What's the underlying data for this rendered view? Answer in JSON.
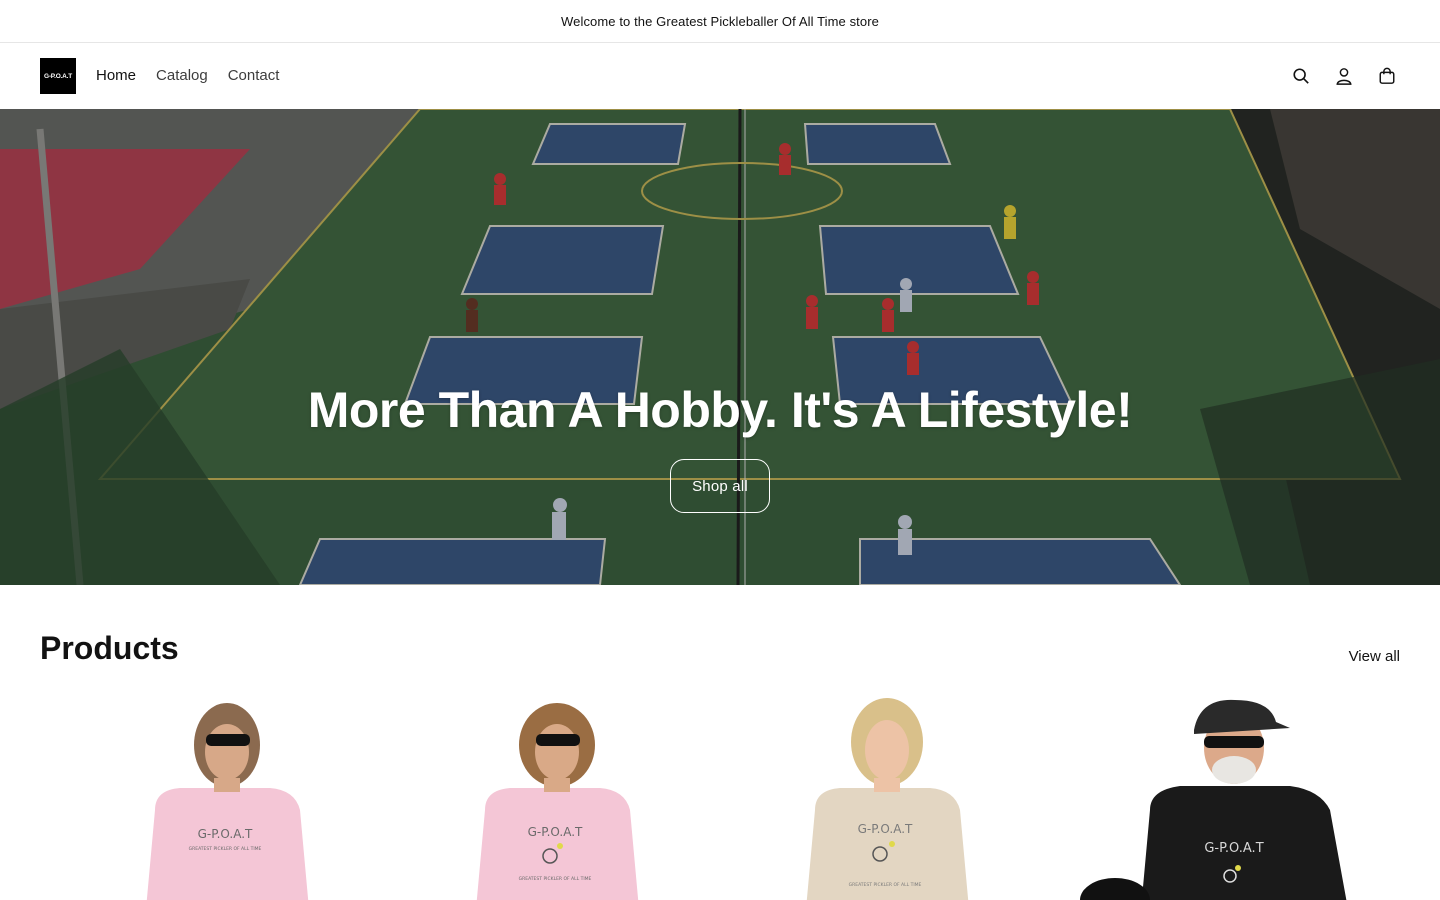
{
  "announcement": {
    "text": "Welcome to the Greatest Pickleballer Of All Time store"
  },
  "header": {
    "logo_text": "G-P.O.A.T",
    "nav": [
      {
        "label": "Home",
        "active": true
      },
      {
        "label": "Catalog",
        "active": false
      },
      {
        "label": "Contact",
        "active": false
      }
    ],
    "icons": [
      "search-icon",
      "account-icon",
      "cart-icon"
    ]
  },
  "hero": {
    "title": "More Than A Hobby. It's A Lifestyle!",
    "button_label": "Shop all",
    "colors": {
      "court_surface": "#3f6b3f",
      "court_blue": "#3a5a8a",
      "line": "#e8e6d8"
    }
  },
  "products": {
    "title": "Products",
    "view_all": "View all",
    "items": [
      {
        "shirt_color": "#f4c6d6",
        "shirt_print": "G-P.O.A.T",
        "shirt_sub": "GREATEST PICKLER OF ALL TIME"
      },
      {
        "shirt_color": "#f4c6d6",
        "shirt_print": "G-P.O.A.T",
        "shirt_sub": "GREATEST PICKLER OF ALL TIME"
      },
      {
        "shirt_color": "#e3d6c2",
        "shirt_print": "G-P.O.A.T",
        "shirt_sub": "GREATEST PICKLER OF ALL TIME"
      },
      {
        "shirt_color": "#1a1a1a",
        "shirt_print": "G-P.O.A.T",
        "shirt_sub": ""
      }
    ]
  },
  "colors": {
    "text": "#121212",
    "border": "#e6e6e6",
    "logo_bg": "#000000"
  }
}
